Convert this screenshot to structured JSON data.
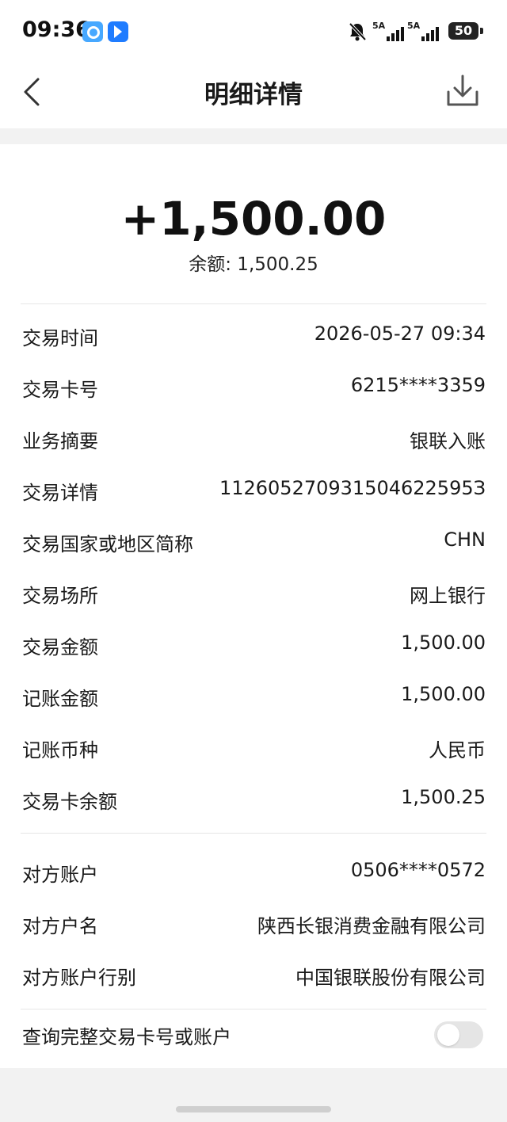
{
  "status": {
    "time": "09:36",
    "signal_1": "5A",
    "signal_2": "5A",
    "battery": "50"
  },
  "header": {
    "title": "明细详情"
  },
  "summary": {
    "amount": "+1,500.00",
    "balance_text": "余额: 1,500.25"
  },
  "details": [
    {
      "label": "交易时间",
      "value": "2026-05-27 09:34"
    },
    {
      "label": "交易卡号",
      "value": "6215****3359"
    },
    {
      "label": "业务摘要",
      "value": "银联入账"
    },
    {
      "label": "交易详情",
      "value": "112605270931504622595З"
    },
    {
      "label": "交易国家或地区简称",
      "value": "CHN"
    },
    {
      "label": "交易场所",
      "value": "网上银行"
    },
    {
      "label": "交易金额",
      "value": "1,500.00"
    },
    {
      "label": "记账金额",
      "value": "1,500.00"
    },
    {
      "label": "记账币种",
      "value": "人民币"
    },
    {
      "label": "交易卡余额",
      "value": "1,500.25"
    }
  ],
  "counterparty": [
    {
      "label": "对方账户",
      "value": "0506****0572"
    },
    {
      "label": "对方户名",
      "value": "陕西长银消费金融有限公司"
    },
    {
      "label": "对方账户行别",
      "value": "中国银联股份有限公司"
    }
  ],
  "query": {
    "label": "查询完整交易卡号或账户",
    "toggle_on": false
  },
  "colors": {
    "background": "#f2f2f2",
    "card": "#ffffff",
    "toggle_off": "#e5e5e5"
  }
}
